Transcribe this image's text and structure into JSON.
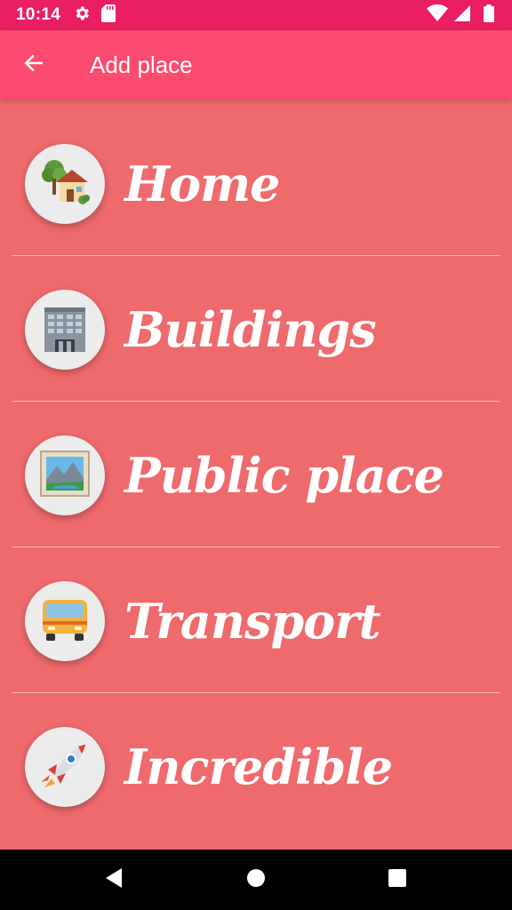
{
  "status_bar": {
    "time": "10:14",
    "icons": [
      "gear-icon",
      "sd-card-icon",
      "wifi-icon",
      "cell-signal-icon",
      "battery-icon"
    ]
  },
  "app_bar": {
    "title": "Add place",
    "back_icon": "arrow-back-icon"
  },
  "places": [
    {
      "label": "Home",
      "icon": "house-with-garden-icon"
    },
    {
      "label": "Buildings",
      "icon": "office-building-icon"
    },
    {
      "label": "Public place",
      "icon": "framed-picture-icon"
    },
    {
      "label": "Transport",
      "icon": "bus-icon"
    },
    {
      "label": "Incredible",
      "icon": "rocket-icon"
    }
  ],
  "nav_bar": {
    "icons": [
      "nav-back-icon",
      "nav-home-icon",
      "nav-recents-icon"
    ]
  },
  "colors": {
    "status_bar": "#e91e63",
    "app_bar": "#fb4b6e",
    "background": "#ee6a6c",
    "circle": "#ececec"
  }
}
